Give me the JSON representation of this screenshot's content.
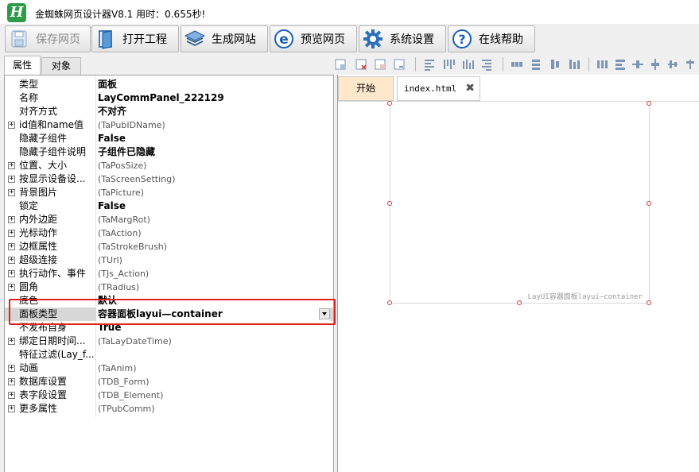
{
  "window": {
    "title": "金蜘蛛网页设计器V8.1 用时：0.655秒!"
  },
  "toolbar": {
    "buttons": [
      {
        "label": "保存网页",
        "icon": "save-icon",
        "enabled": false
      },
      {
        "label": "打开工程",
        "icon": "open-project-icon",
        "enabled": true
      },
      {
        "label": "生成网站",
        "icon": "layers-icon",
        "enabled": true
      },
      {
        "label": "预览网页",
        "icon": "browser-e-icon",
        "enabled": true
      },
      {
        "label": "系统设置",
        "icon": "gear-icon",
        "enabled": true
      },
      {
        "label": "在线帮助",
        "icon": "help-icon",
        "enabled": true
      }
    ]
  },
  "left_tabs": {
    "properties": "属性",
    "objects": "对象"
  },
  "properties": [
    {
      "name": "类型",
      "value": "面板",
      "style": "bold",
      "expandable": false
    },
    {
      "name": "名称",
      "value": "LayCommPanel_222129",
      "style": "bold",
      "expandable": false
    },
    {
      "name": "对齐方式",
      "value": "不对齐",
      "style": "bold",
      "expandable": false
    },
    {
      "name": "id值和name值",
      "value": "(TaPubIDName)",
      "style": "gray",
      "expandable": true
    },
    {
      "name": "隐藏子组件",
      "value": "False",
      "style": "bold",
      "expandable": false
    },
    {
      "name": "隐藏子组件说明",
      "value": "子组件已隐藏",
      "style": "bold",
      "expandable": false
    },
    {
      "name": "位置、大小",
      "value": "(TaPosSize)",
      "style": "gray",
      "expandable": true
    },
    {
      "name": "按显示设备设...",
      "value": "(TaScreenSetting)",
      "style": "gray",
      "expandable": true
    },
    {
      "name": "背景图片",
      "value": "(TaPicture)",
      "style": "gray",
      "expandable": true
    },
    {
      "name": "锁定",
      "value": "False",
      "style": "bold",
      "expandable": false
    },
    {
      "name": "内外边距",
      "value": "(TaMargRot)",
      "style": "gray",
      "expandable": true
    },
    {
      "name": "光标动作",
      "value": "(TaAction)",
      "style": "gray",
      "expandable": true
    },
    {
      "name": "边框属性",
      "value": "(TaStrokeBrush)",
      "style": "gray",
      "expandable": true
    },
    {
      "name": "超级连接",
      "value": "(TUrl)",
      "style": "gray",
      "expandable": true
    },
    {
      "name": "执行动作、事件",
      "value": "(TJs_Action)",
      "style": "gray",
      "expandable": true
    },
    {
      "name": "圆角",
      "value": "(TRadius)",
      "style": "gray",
      "expandable": true
    },
    {
      "name": "底色",
      "value": "默认",
      "style": "bold",
      "expandable": false
    },
    {
      "name": "面板类型",
      "value": "容器面板layui—container",
      "style": "bold",
      "expandable": false,
      "selected": true
    },
    {
      "name": "不发布自身",
      "value": "True",
      "style": "bold",
      "expandable": false
    },
    {
      "name": "绑定日期时间...",
      "value": "(TaLayDateTime)",
      "style": "gray",
      "expandable": true
    },
    {
      "name": "特征过滤(Lay_f...",
      "value": "",
      "style": "bold",
      "expandable": false
    },
    {
      "name": "动画",
      "value": "(TaAnim)",
      "style": "gray",
      "expandable": true
    },
    {
      "name": "数据库设置",
      "value": "(TDB_Form)",
      "style": "gray",
      "expandable": true
    },
    {
      "name": "表字段设置",
      "value": "(TDB_Element)",
      "style": "gray",
      "expandable": true
    },
    {
      "name": "更多属性",
      "value": "(TPubComm)",
      "style": "gray",
      "expandable": true
    }
  ],
  "doc_tabs": {
    "start": "开始",
    "file": "index.html",
    "close_glyph": "✖"
  },
  "canvas": {
    "panel_caption": "LayUI容器面板layui—container"
  },
  "colors": {
    "highlight": "#e0201a",
    "start_tab": "#fde8cc",
    "logo": "#2f9a4a",
    "handle": "#dd3333"
  }
}
